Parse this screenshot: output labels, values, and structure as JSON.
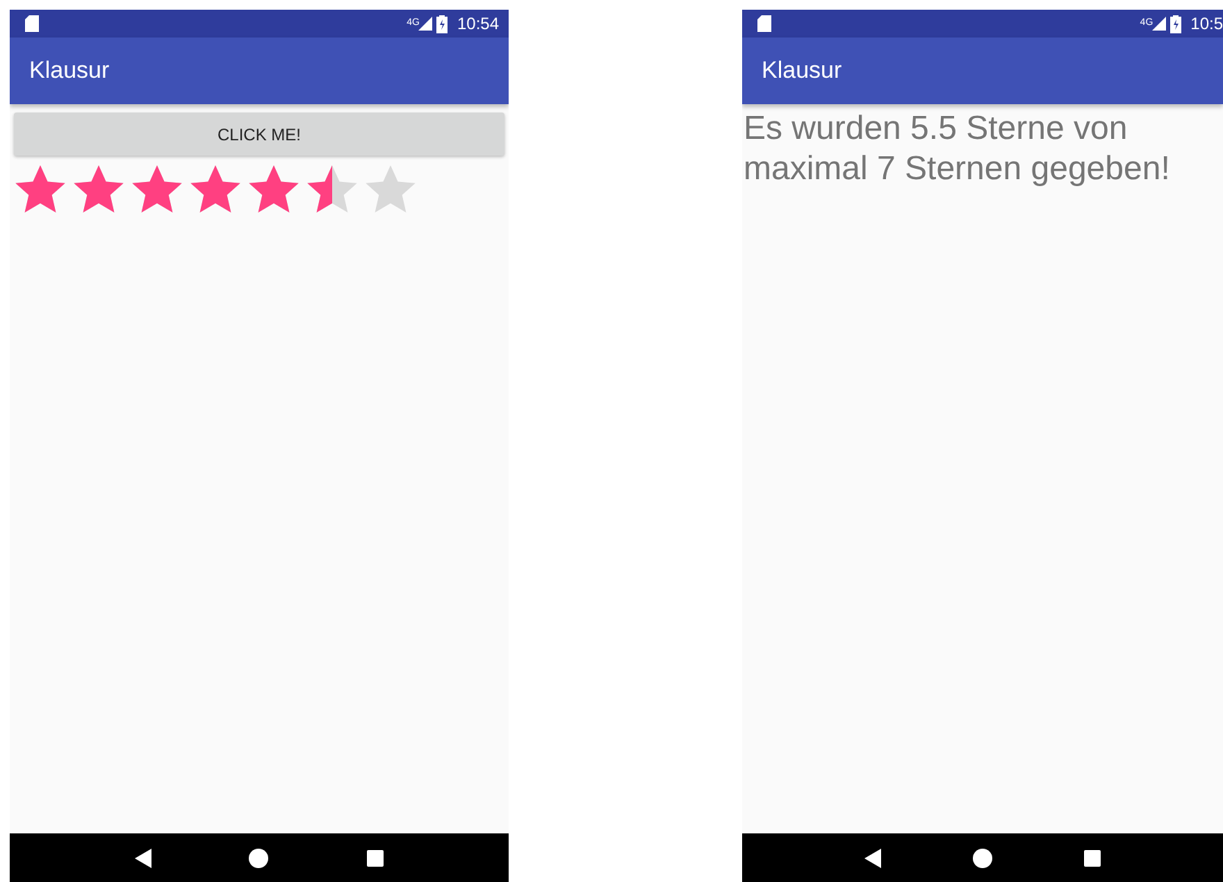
{
  "screens": [
    {
      "status_bar": {
        "network": "4G",
        "time": "10:54"
      },
      "app_bar": {
        "title": "Klausur"
      },
      "kind": "rating",
      "button": "CLICK ME!",
      "rating": {
        "stars": 5.5
      }
    },
    {
      "status_bar": {
        "network": "4G",
        "time": "10:5"
      },
      "app_bar": {
        "title": "Klausur"
      },
      "kind": "message",
      "message": "Es wurden 5.5 Sterne von maximal 7 Sternen gegeben!"
    }
  ]
}
